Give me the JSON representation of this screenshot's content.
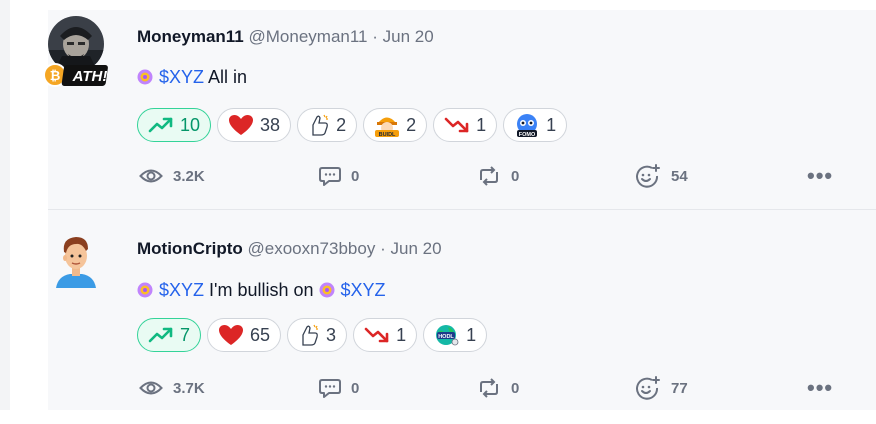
{
  "posts": [
    {
      "author": "Moneyman11",
      "handle": "@Moneyman11",
      "separator": "·",
      "date": "Jun 20",
      "avatar_badge": "ATH!",
      "text_parts": {
        "cashtag1": "$XYZ",
        "after1": " All in"
      },
      "reactions": [
        {
          "icon": "trending-up-icon",
          "count": "10"
        },
        {
          "icon": "heart-icon",
          "count": "38"
        },
        {
          "icon": "thumbs-up-icon",
          "count": "2"
        },
        {
          "icon": "buidl-icon",
          "count": "2"
        },
        {
          "icon": "trending-down-icon",
          "count": "1"
        },
        {
          "icon": "fomo-icon",
          "count": "1"
        }
      ],
      "stats": {
        "views": "3.2K",
        "comments": "0",
        "reposts": "0",
        "tips": "54"
      },
      "more": "•••"
    },
    {
      "author": "MotionCripto",
      "handle": "@exooxn73bboy",
      "separator": "·",
      "date": "Jun 20",
      "text_parts": {
        "cashtag1": "$XYZ",
        "after1": " I'm bullish on ",
        "cashtag2": "$XYZ"
      },
      "reactions": [
        {
          "icon": "trending-up-icon",
          "count": "7"
        },
        {
          "icon": "heart-icon",
          "count": "65"
        },
        {
          "icon": "thumbs-up-icon",
          "count": "3"
        },
        {
          "icon": "trending-down-icon",
          "count": "1"
        },
        {
          "icon": "hodl-icon",
          "count": "1"
        }
      ],
      "stats": {
        "views": "3.7K",
        "comments": "0",
        "reposts": "0",
        "tips": "77"
      },
      "more": "•••"
    }
  ],
  "colors": {
    "cashtag": "#2563eb",
    "bullish_active": "#34d399",
    "heart": "#dc2626",
    "bearish": "#dc2626"
  }
}
